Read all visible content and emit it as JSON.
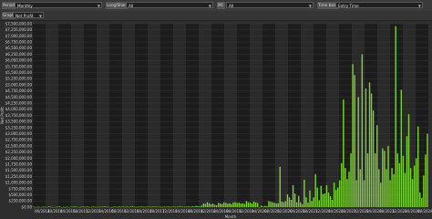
{
  "toolbar": {
    "period_label": "Period",
    "period_value": "Monthly",
    "long_short_label": "Long/Short",
    "long_short_value": "All",
    "mc_label": "MC",
    "mc_value": "All",
    "time_base_label": "Time base",
    "time_base_value": "Entry Time",
    "graph_label": "Graph",
    "graph_value": "Net Profit"
  },
  "colors": {
    "positive_bar": "#7ad12f",
    "negative_bar": "#d22a2a",
    "band_dark": "#1c1c1c",
    "band_light": "#2a2a2a",
    "grid": "#3c3c3c"
  },
  "chart_data": {
    "type": "bar",
    "xlabel": "Month",
    "ylabel": "Net Profit",
    "ylim": [
      0,
      7500000
    ],
    "y_ticks": [
      0,
      250000,
      500000,
      750000,
      1000000,
      1250000,
      1500000,
      1750000,
      2000000,
      2250000,
      2500000,
      2750000,
      3000000,
      3250000,
      3500000,
      3750000,
      4000000,
      4250000,
      4500000,
      4750000,
      5000000,
      5250000,
      5500000,
      5750000,
      6000000,
      6250000,
      6500000,
      6750000,
      7000000,
      7250000,
      7500000
    ],
    "y_tick_labels": [
      "$0.00",
      "$250,000.00",
      "$500,000.00",
      "$750,000.00",
      "$1,000,000.00",
      "$1,250,000.00",
      "$1,500,000.00",
      "$1,750,000.00",
      "$2,000,000.00",
      "$2,250,000.00",
      "$2,500,000.00",
      "$2,750,000.00",
      "$3,000,000.00",
      "$3,250,000.00",
      "$3,500,000.00",
      "$3,750,000.00",
      "$4,000,000.00",
      "$4,250,000.00",
      "$4,500,000.00",
      "$4,750,000.00",
      "$5,000,000.00",
      "$5,250,000.00",
      "$5,500,000.00",
      "$5,750,000.00",
      "$6,000,000.00",
      "$6,250,000.00",
      "$6,500,000.00",
      "$6,750,000.00",
      "$7,000,000.00",
      "$7,250,000.00",
      "$7,500,000.00"
    ],
    "x_tick_labels": [
      "06/2014",
      "10/2014",
      "04/2015",
      "08/2015",
      "12/2015",
      "04/2016",
      "08/2016",
      "12/2016",
      "04/2017",
      "08/2017",
      "12/2017",
      "04/2018",
      "08/2018",
      "12/2018",
      "04/2019",
      "08/2019",
      "12/2019",
      "04/2020",
      "08/2020",
      "12/2020",
      "04/2021",
      "08/2021",
      "12/2021",
      "04/2022",
      "08/2022",
      "12/2022",
      "04/2023",
      "08/2023",
      "12/2023",
      "04/2024",
      "08/2024"
    ],
    "values": [
      20000,
      -30000,
      15000,
      10000,
      -20000,
      25000,
      15000,
      -15000,
      30000,
      20000,
      10000,
      -25000,
      15000,
      20000,
      30000,
      -10000,
      15000,
      10000,
      20000,
      -20000,
      25000,
      15000,
      30000,
      20000,
      -15000,
      10000,
      25000,
      20000,
      15000,
      30000,
      -10000,
      20000,
      25000,
      15000,
      10000,
      20000,
      15000,
      25000,
      30000,
      20000,
      15000,
      -20000,
      10000,
      25000,
      20000,
      15000,
      30000,
      20000,
      25000,
      15000,
      20000,
      10000,
      25000,
      30000,
      20000,
      15000,
      25000,
      20000,
      30000,
      20000,
      15000,
      25000,
      20000,
      15000,
      30000,
      20000,
      25000,
      15000,
      20000,
      10000,
      25000,
      20000,
      30000,
      15000,
      20000,
      25000,
      15000,
      20000,
      30000,
      25000,
      20000,
      15000,
      25000,
      30000,
      20000,
      40000,
      25000,
      50000,
      40000,
      30000,
      60000,
      150000,
      130000,
      200000,
      160000,
      120000,
      150000,
      100000,
      80000,
      180000,
      150000,
      130000,
      200000,
      170000,
      140000,
      160000,
      120000,
      190000,
      200000,
      170000,
      180000,
      150000,
      160000,
      130000,
      250000,
      200000,
      180000,
      140000,
      230000,
      190000,
      170000,
      -50000,
      60000,
      30000,
      50000,
      40000,
      250000,
      220000,
      200000,
      180000,
      150000,
      160000,
      1650000,
      230000,
      200000,
      250000,
      530000,
      400000,
      300000,
      900000,
      550000,
      200000,
      460000,
      200000,
      120000,
      1120000,
      400000,
      180000,
      680000,
      250000,
      400000,
      1350000,
      800000,
      280000,
      870000,
      530000,
      560000,
      900000,
      600000,
      450000,
      300000,
      1000000,
      700000,
      800000,
      1100000,
      1800000,
      4400000,
      1600000,
      1150000,
      1450000,
      2200000,
      5850000,
      5400000,
      1100000,
      4500000,
      1550000,
      6250000,
      1100000,
      4850000,
      2200000,
      5100000,
      4650000,
      3950000,
      2200000,
      3350000,
      1550000,
      1000000,
      2400000,
      2300000,
      1550000,
      2500000,
      1100000,
      1600000,
      1350000,
      7400000,
      2200000,
      1800000,
      4800000,
      2100000,
      1400000,
      2900000,
      3800000,
      1600000,
      1150000,
      1700000,
      2000000,
      3300000,
      600000,
      380000,
      1300000,
      2150000,
      3000000
    ]
  }
}
